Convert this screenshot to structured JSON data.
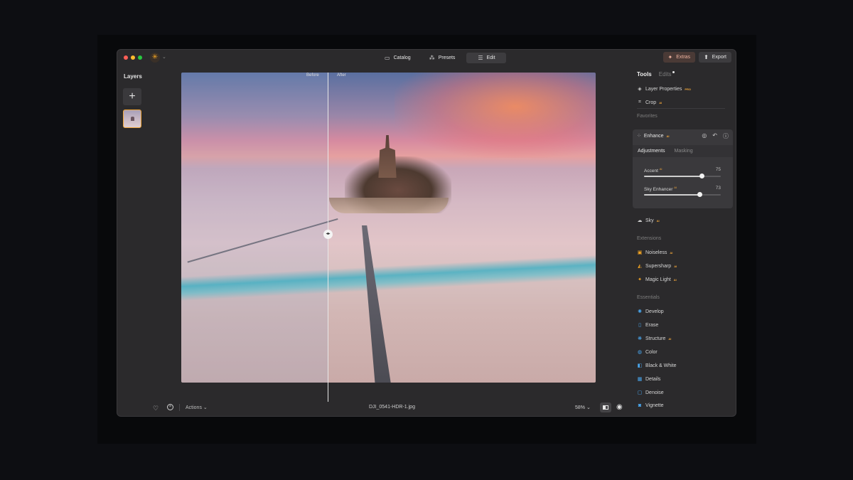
{
  "window": {
    "traffic_colors": [
      "#ff5f57",
      "#febc2e",
      "#28c840"
    ],
    "app_icon": "sun-logo-icon"
  },
  "toolbar": {
    "tabs": [
      {
        "label": "Catalog",
        "icon": "folder-icon",
        "active": false
      },
      {
        "label": "Presets",
        "icon": "presets-icon",
        "active": false
      },
      {
        "label": "Edit",
        "icon": "sliders-icon",
        "active": true
      }
    ],
    "extras_label": "Extras",
    "export_label": "Export"
  },
  "layers": {
    "title": "Layers",
    "add_label": "+"
  },
  "canvas": {
    "before_label": "Before",
    "after_label": "After",
    "split_fraction": 0.354
  },
  "bottom": {
    "actions_label": "Actions",
    "filename": "DJI_0541-HDR-1.jpg",
    "zoom": "58%"
  },
  "panel": {
    "tab_tools": "Tools",
    "tab_edits": "Edits",
    "top_tools": [
      {
        "label": "Layer Properties",
        "badge": "PRO",
        "icon": "layers-icon"
      },
      {
        "label": "Crop",
        "badge": "AI",
        "icon": "crop-icon"
      }
    ],
    "favorites_label": "Favorites",
    "enhance": {
      "label": "Enhance",
      "badge": "AI",
      "tab_adjustments": "Adjustments",
      "tab_masking": "Masking",
      "sliders": [
        {
          "label": "Accent",
          "badge": "AI",
          "value": 75
        },
        {
          "label": "Sky Enhancer",
          "badge": "AI",
          "value": 73
        }
      ]
    },
    "sky": {
      "label": "Sky",
      "badge": "AI"
    },
    "extensions_label": "Extensions",
    "extensions": [
      {
        "label": "Noiseless",
        "badge": "AI"
      },
      {
        "label": "Supersharp",
        "badge": "AI"
      },
      {
        "label": "Magic Light",
        "badge": "AI"
      }
    ],
    "essentials_label": "Essentials",
    "essentials": [
      {
        "label": "Develop",
        "badge": ""
      },
      {
        "label": "Erase",
        "badge": ""
      },
      {
        "label": "Structure",
        "badge": "AI"
      },
      {
        "label": "Color",
        "badge": ""
      },
      {
        "label": "Black & White",
        "badge": ""
      },
      {
        "label": "Details",
        "badge": ""
      },
      {
        "label": "Denoise",
        "badge": ""
      },
      {
        "label": "Vignette",
        "badge": ""
      }
    ]
  },
  "colors": {
    "accent": "#f0a63a",
    "extensions_icon": "#f5a623",
    "essentials_icon": "#4aa8f0"
  }
}
